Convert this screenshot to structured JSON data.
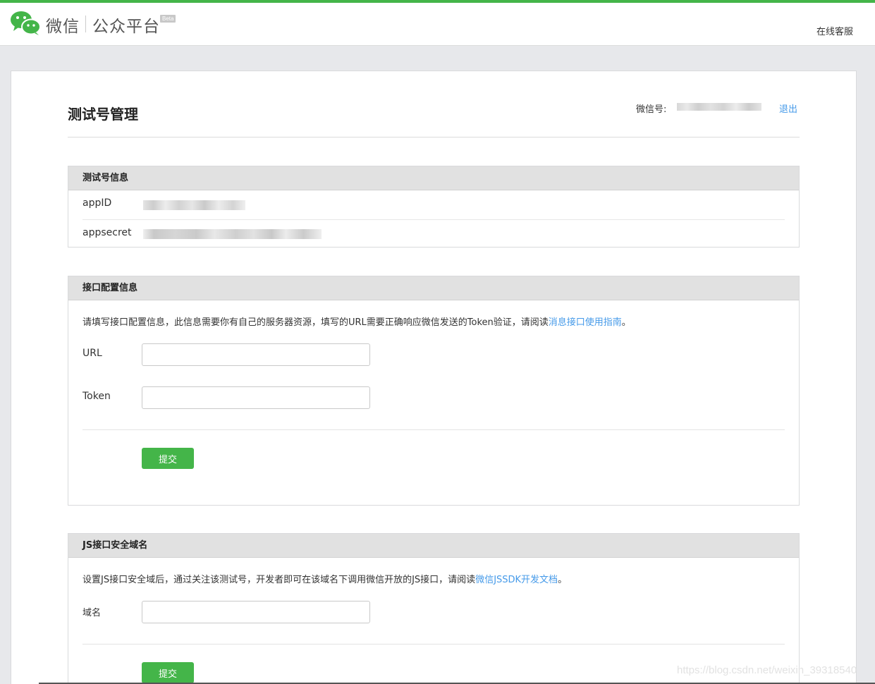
{
  "header": {
    "brand_wechat": "微信",
    "brand_platform": "公众平台",
    "beta_badge": "Beta",
    "service_link": "在线客服",
    "logo_icon": "wechat-logo-icon",
    "accent_color": "#44b549"
  },
  "page": {
    "title": "测试号管理",
    "account_label": "微信号:",
    "logout_label": "退出"
  },
  "test_account": {
    "heading": "测试号信息",
    "appid_label": "appID",
    "appsecret_label": "appsecret"
  },
  "interface_config": {
    "heading": "接口配置信息",
    "description": "请填写接口配置信息，此信息需要你有自己的服务器资源，填写的URL需要正确响应微信发送的Token验证，请阅读",
    "guide_link": "消息接口使用指南",
    "period": "。",
    "url_label": "URL",
    "url_value": "",
    "token_label": "Token",
    "token_value": "",
    "submit_label": "提交"
  },
  "js_domain": {
    "heading": "JS接口安全域名",
    "description": "设置JS接口安全域后，通过关注该测试号，开发者即可在该域名下调用微信开放的JS接口，请阅读",
    "doc_link": "微信JSSDK开发文档",
    "period": "。",
    "domain_label": "域名",
    "domain_value": "",
    "submit_label": "提交"
  },
  "watermark": "https://blog.csdn.net/weixin_39318540"
}
